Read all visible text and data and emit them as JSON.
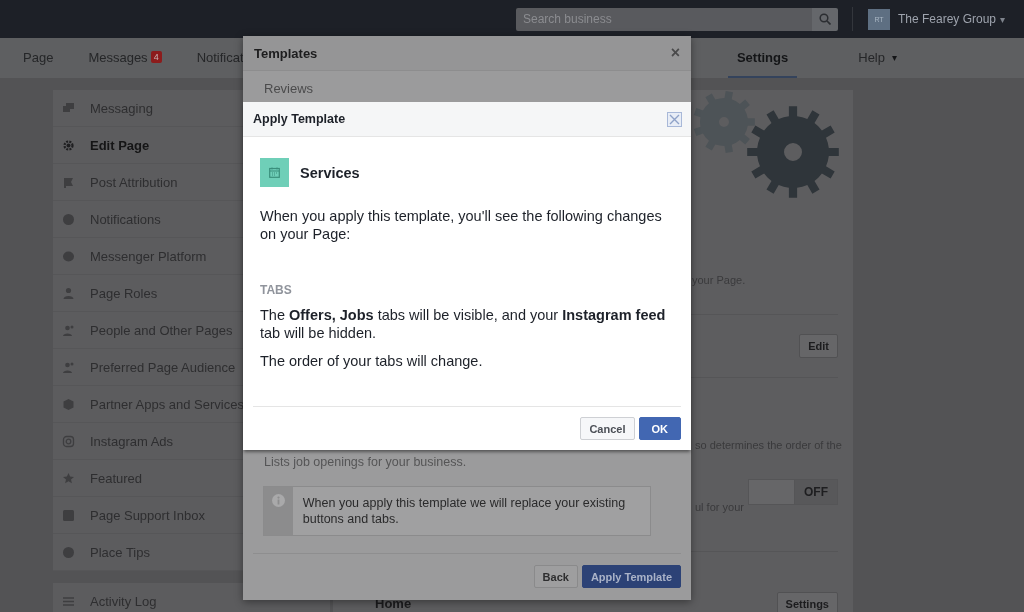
{
  "top_bar": {
    "search": {
      "placeholder": "Search business"
    },
    "account": {
      "initials": "RT",
      "name": "The Fearey Group",
      "caret": "▾"
    }
  },
  "page_nav": {
    "tabs": [
      {
        "label": "Page",
        "selected": false
      },
      {
        "label": "Messages",
        "badge": "4",
        "selected": false
      },
      {
        "label": "Notificat",
        "selected": false
      },
      {
        "label": "Settings",
        "selected": true
      },
      {
        "label": "Help",
        "caret": "▾",
        "selected": false
      }
    ]
  },
  "sidebar": {
    "items": [
      {
        "label": "Messaging",
        "selected": false
      },
      {
        "label": "Edit Page",
        "selected": true
      },
      {
        "label": "Post Attribution",
        "selected": false
      },
      {
        "label": "Notifications",
        "selected": false
      },
      {
        "label": "Messenger Platform",
        "selected": false
      },
      {
        "label": "Page Roles",
        "selected": false
      },
      {
        "label": "People and Other Pages",
        "selected": false
      },
      {
        "label": "Preferred Page Audience",
        "selected": false
      },
      {
        "label": "Partner Apps and Services",
        "selected": false
      },
      {
        "label": "Instagram Ads",
        "selected": false
      },
      {
        "label": "Featured",
        "selected": false
      },
      {
        "label": "Page Support Inbox",
        "selected": false
      },
      {
        "label": "Place Tips",
        "selected": false
      }
    ],
    "footer_item": {
      "label": "Activity Log"
    }
  },
  "main_panel": {
    "text_1": "your Page.",
    "edit_button": "Edit",
    "text_2": "so determines the order of the",
    "toggle": {
      "label": "OFF",
      "on": false
    },
    "text_3": "ul for your",
    "heading": "Home",
    "settings_button": "Settings"
  },
  "templates_dialog": {
    "title": "Templates",
    "close": "×",
    "item": "Reviews",
    "description": "Lists job openings for your business.",
    "notice": "When you apply this template we will replace your existing buttons and tabs.",
    "buttons": [
      {
        "label": "Back",
        "kind": "secondary"
      },
      {
        "label": "Apply Template",
        "kind": "primary"
      }
    ]
  },
  "apply_dialog": {
    "title": "Apply Template",
    "template_name": "Services",
    "intro": "When you apply this template, you'll see the following changes on your Page:",
    "section": "TABS",
    "changes": [
      "The **Offers, Jobs** tabs will be visible, and your **Instagram feed** tab will be hidden.",
      "The order of your tabs will change."
    ],
    "buttons": [
      {
        "label": "Cancel",
        "kind": "secondary"
      },
      {
        "label": "OK",
        "kind": "primary"
      }
    ]
  }
}
